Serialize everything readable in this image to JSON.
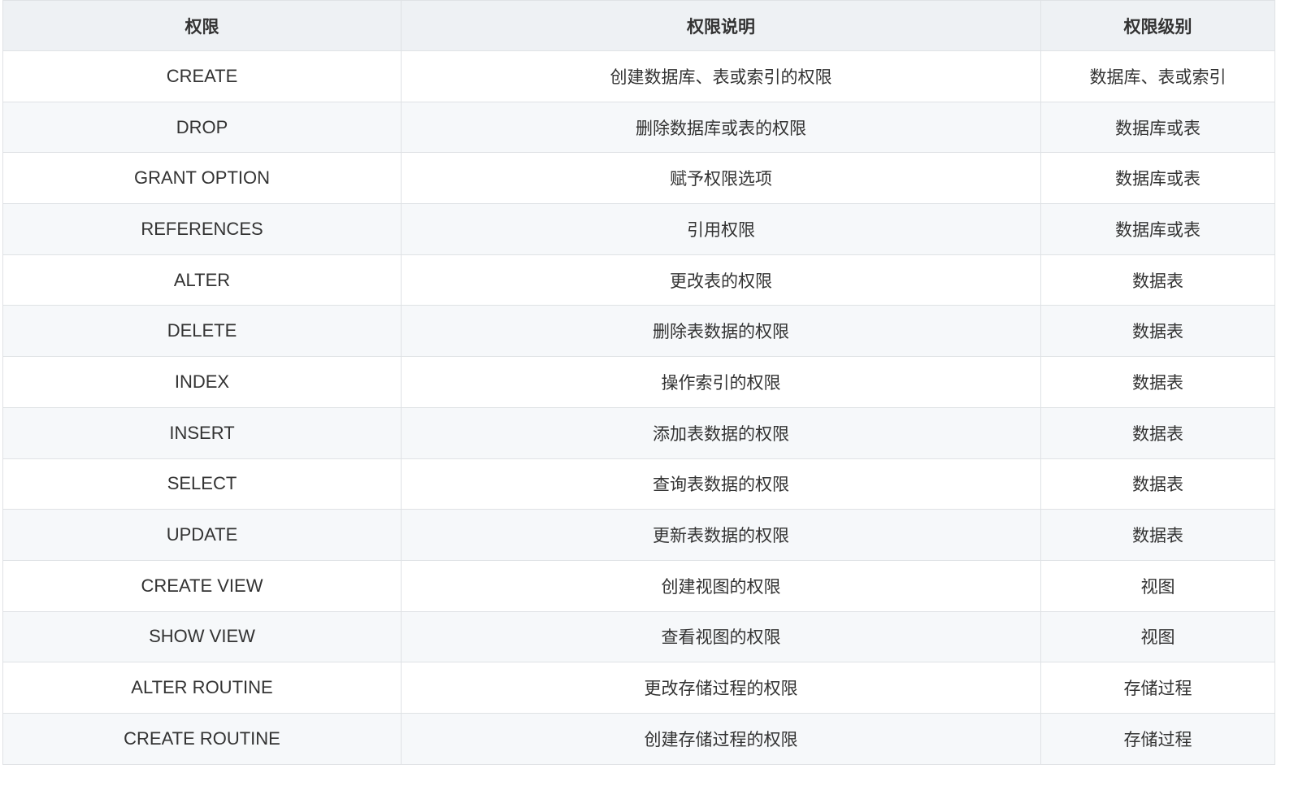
{
  "table": {
    "headers": [
      "权限",
      "权限说明",
      "权限级别"
    ],
    "rows": [
      [
        "CREATE",
        "创建数据库、表或索引的权限",
        "数据库、表或索引"
      ],
      [
        "DROP",
        "删除数据库或表的权限",
        "数据库或表"
      ],
      [
        "GRANT OPTION",
        "赋予权限选项",
        "数据库或表"
      ],
      [
        "REFERENCES",
        "引用权限",
        "数据库或表"
      ],
      [
        "ALTER",
        "更改表的权限",
        "数据表"
      ],
      [
        "DELETE",
        "删除表数据的权限",
        "数据表"
      ],
      [
        "INDEX",
        "操作索引的权限",
        "数据表"
      ],
      [
        "INSERT",
        "添加表数据的权限",
        "数据表"
      ],
      [
        "SELECT",
        "查询表数据的权限",
        "数据表"
      ],
      [
        "UPDATE",
        "更新表数据的权限",
        "数据表"
      ],
      [
        "CREATE VIEW",
        "创建视图的权限",
        "视图"
      ],
      [
        "SHOW VIEW",
        "查看视图的权限",
        "视图"
      ],
      [
        "ALTER ROUTINE",
        "更改存储过程的权限",
        "存储过程"
      ],
      [
        "CREATE ROUTINE",
        "创建存储过程的权限",
        "存储过程"
      ]
    ]
  }
}
